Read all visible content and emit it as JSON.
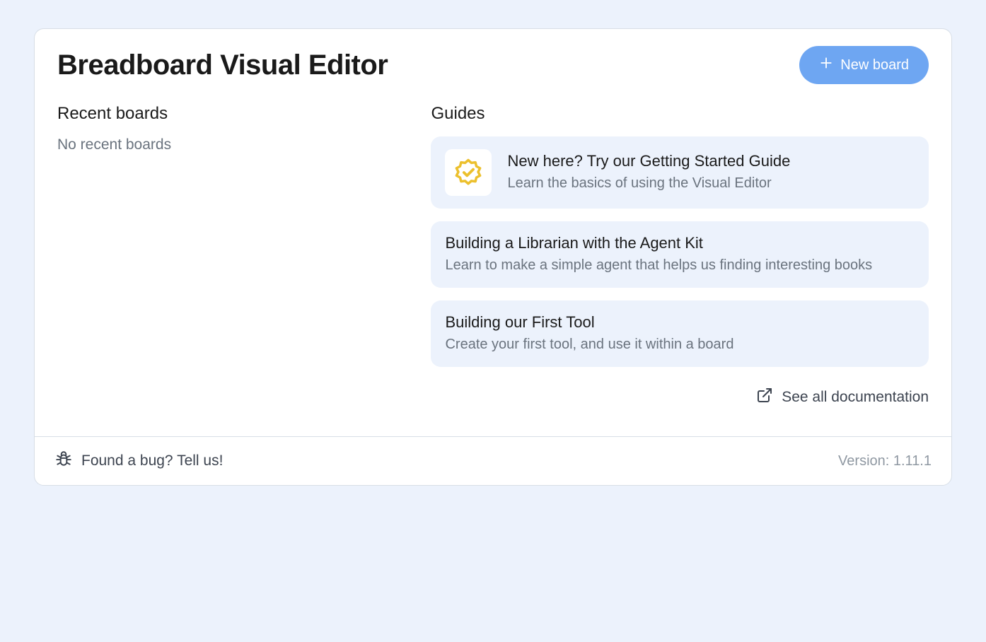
{
  "header": {
    "title": "Breadboard Visual Editor",
    "new_board_label": "New board"
  },
  "recent": {
    "heading": "Recent boards",
    "empty_message": "No recent boards"
  },
  "guides": {
    "heading": "Guides",
    "items": [
      {
        "title": "New here? Try our Getting Started Guide",
        "description": "Learn the basics of using the Visual Editor",
        "icon": "verified-badge-icon"
      },
      {
        "title": "Building a Librarian with the Agent Kit",
        "description": "Learn to make a simple agent that helps us finding interesting books"
      },
      {
        "title": "Building our First Tool",
        "description": "Create your first tool, and use it within a board"
      }
    ],
    "see_all_label": "See all documentation"
  },
  "footer": {
    "bug_label": "Found a bug? Tell us!",
    "version_label": "Version: 1.11.1"
  }
}
